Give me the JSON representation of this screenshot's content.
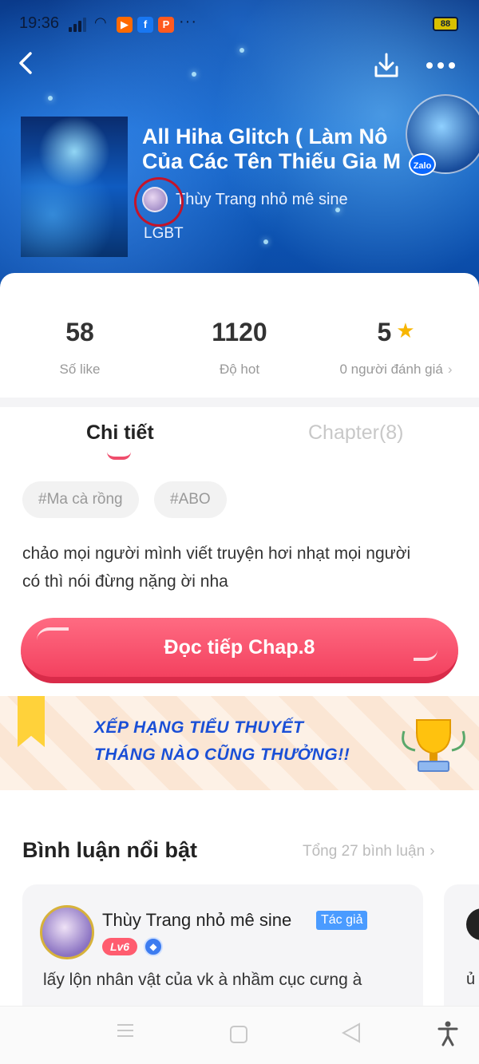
{
  "status_bar": {
    "time": "19:36",
    "more": "···",
    "battery": "88",
    "app_icons": [
      "media-icon",
      "facebook-icon",
      "p-icon"
    ]
  },
  "header": {
    "title_line1": "All Hiha Glitch ( Làm Nô",
    "title_line2": "Của Các Tên Thiếu Gia M",
    "author": "Thùy Trang nhỏ mê sine",
    "genre": "LGBT",
    "zalo_label": "Zalo"
  },
  "stats": {
    "likes_value": "58",
    "likes_label": "Số like",
    "hot_value": "1120",
    "hot_label": "Độ hot",
    "rating_value": "5",
    "rating_label": "0 người đánh giá"
  },
  "tabs": {
    "detail": "Chi tiết",
    "chapter": "Chapter(8)"
  },
  "tags": [
    "#Ma cà rồng",
    "#ABO"
  ],
  "description_line1": "chảo mọi người mình viết truyện hơi nhạt mọi người",
  "description_line2": "có thì nói đừng nặng ời nha",
  "read_button": "Đọc tiếp Chap.8",
  "banner": {
    "line1": "XẾP HẠNG TIỂU THUYẾT",
    "line2": "THÁNG NÀO CŨNG THƯỞNG!!"
  },
  "comments": {
    "title": "Bình luận nổi bật",
    "total": "Tổng 27 bình luận",
    "first": {
      "name": "Thùy Trang nhỏ mê sine",
      "badge": "Tác giả",
      "level": "Lv6",
      "text": "lấy lộn nhân vật của vk à nhầm cục cưng à"
    },
    "next_partial_text": "ủ"
  },
  "colors": {
    "accent": "#f3415f",
    "header_blue": "#0d5fc5",
    "banner_text": "#1a4fd6",
    "star": "#f7b500"
  }
}
